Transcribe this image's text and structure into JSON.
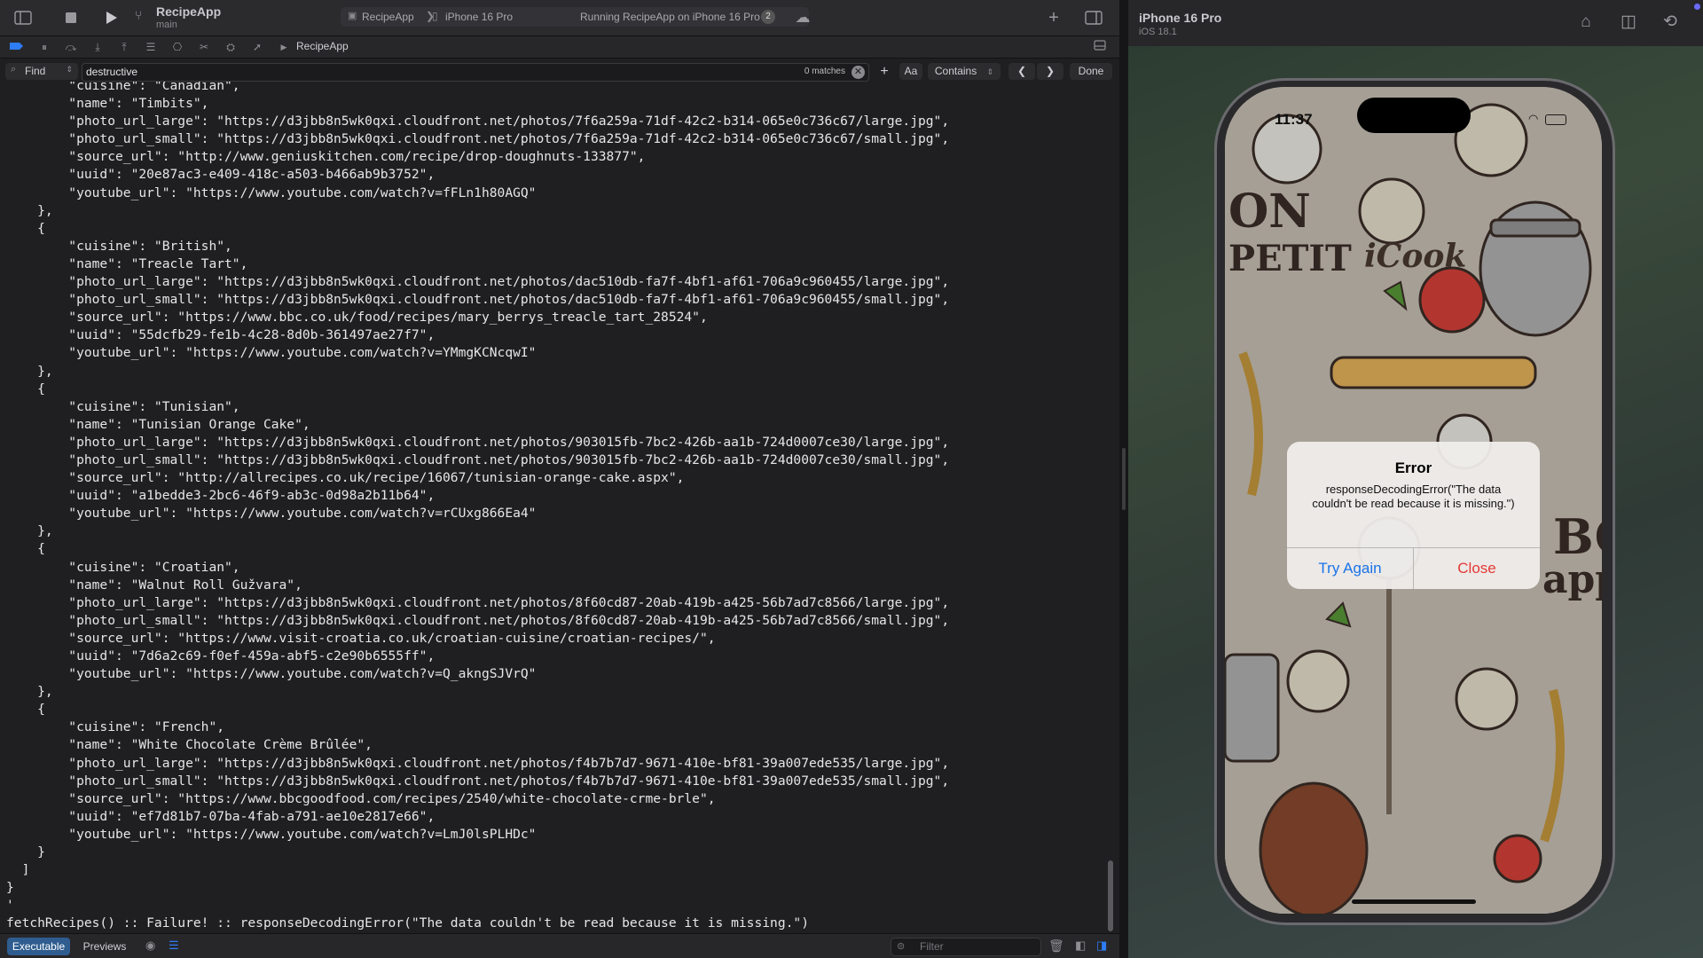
{
  "toolbar": {
    "app_name": "RecipeApp",
    "branch": "main",
    "run_destination_app": "RecipeApp",
    "run_destination_device": "iPhone 16 Pro",
    "run_status": "Running RecipeApp on iPhone 16 Pro",
    "issue_badge": "2"
  },
  "debug_bar": {
    "target": "RecipeApp"
  },
  "find_bar": {
    "mode": "Find",
    "query": "destructive",
    "match_count": "0 matches",
    "case_toggle": "Aa",
    "match_type": "Contains",
    "done_label": "Done"
  },
  "console": {
    "lines": [
      "        \"cuisine\": \"Canadian\",",
      "        \"name\": \"Timbits\",",
      "        \"photo_url_large\": \"https://d3jbb8n5wk0qxi.cloudfront.net/photos/7f6a259a-71df-42c2-b314-065e0c736c67/large.jpg\",",
      "        \"photo_url_small\": \"https://d3jbb8n5wk0qxi.cloudfront.net/photos/7f6a259a-71df-42c2-b314-065e0c736c67/small.jpg\",",
      "        \"source_url\": \"http://www.geniuskitchen.com/recipe/drop-doughnuts-133877\",",
      "        \"uuid\": \"20e87ac3-e409-418c-a503-b466ab9b3752\",",
      "        \"youtube_url\": \"https://www.youtube.com/watch?v=fFLn1h80AGQ\"",
      "    },",
      "    {",
      "        \"cuisine\": \"British\",",
      "        \"name\": \"Treacle Tart\",",
      "        \"photo_url_large\": \"https://d3jbb8n5wk0qxi.cloudfront.net/photos/dac510db-fa7f-4bf1-af61-706a9c960455/large.jpg\",",
      "        \"photo_url_small\": \"https://d3jbb8n5wk0qxi.cloudfront.net/photos/dac510db-fa7f-4bf1-af61-706a9c960455/small.jpg\",",
      "        \"source_url\": \"https://www.bbc.co.uk/food/recipes/mary_berrys_treacle_tart_28524\",",
      "        \"uuid\": \"55dcfb29-fe1b-4c28-8d0b-361497ae27f7\",",
      "        \"youtube_url\": \"https://www.youtube.com/watch?v=YMmgKCNcqwI\"",
      "    },",
      "    {",
      "        \"cuisine\": \"Tunisian\",",
      "        \"name\": \"Tunisian Orange Cake\",",
      "        \"photo_url_large\": \"https://d3jbb8n5wk0qxi.cloudfront.net/photos/903015fb-7bc2-426b-aa1b-724d0007ce30/large.jpg\",",
      "        \"photo_url_small\": \"https://d3jbb8n5wk0qxi.cloudfront.net/photos/903015fb-7bc2-426b-aa1b-724d0007ce30/small.jpg\",",
      "        \"source_url\": \"http://allrecipes.co.uk/recipe/16067/tunisian-orange-cake.aspx\",",
      "        \"uuid\": \"a1bedde3-2bc6-46f9-ab3c-0d98a2b11b64\",",
      "        \"youtube_url\": \"https://www.youtube.com/watch?v=rCUxg866Ea4\"",
      "    },",
      "    {",
      "        \"cuisine\": \"Croatian\",",
      "        \"name\": \"Walnut Roll Gužvara\",",
      "        \"photo_url_large\": \"https://d3jbb8n5wk0qxi.cloudfront.net/photos/8f60cd87-20ab-419b-a425-56b7ad7c8566/large.jpg\",",
      "        \"photo_url_small\": \"https://d3jbb8n5wk0qxi.cloudfront.net/photos/8f60cd87-20ab-419b-a425-56b7ad7c8566/small.jpg\",",
      "        \"source_url\": \"https://www.visit-croatia.co.uk/croatian-cuisine/croatian-recipes/\",",
      "        \"uuid\": \"7d6a2c69-f0ef-459a-abf5-c2e90b6555ff\",",
      "        \"youtube_url\": \"https://www.youtube.com/watch?v=Q_akngSJVrQ\"",
      "    },",
      "    {",
      "        \"cuisine\": \"French\",",
      "        \"name\": \"White Chocolate Crème Brûlée\",",
      "        \"photo_url_large\": \"https://d3jbb8n5wk0qxi.cloudfront.net/photos/f4b7b7d7-9671-410e-bf81-39a007ede535/large.jpg\",",
      "        \"photo_url_small\": \"https://d3jbb8n5wk0qxi.cloudfront.net/photos/f4b7b7d7-9671-410e-bf81-39a007ede535/small.jpg\",",
      "        \"source_url\": \"https://www.bbcgoodfood.com/recipes/2540/white-chocolate-crme-brle\",",
      "        \"uuid\": \"ef7d81b7-07ba-4fab-a791-ae10e2817e66\",",
      "        \"youtube_url\": \"https://www.youtube.com/watch?v=LmJ0lsPLHDc\"",
      "    }",
      "  ]",
      "}",
      "'",
      "fetchRecipes() :: Failure! :: responseDecodingError(\"The data couldn't be read because it is missing.\")"
    ]
  },
  "bottom_bar": {
    "executable_label": "Executable",
    "previews_label": "Previews",
    "filter_placeholder": "Filter"
  },
  "simulator": {
    "device_name": "iPhone 16 Pro",
    "os_version": "iOS 18.1",
    "clock": "11:37",
    "app_logo": "iCook",
    "background_text_1": "ON",
    "background_text_2": "PETIT",
    "background_text_3": "BO",
    "background_text_4": "appe",
    "alert": {
      "title": "Error",
      "message": "responseDecodingError(\"The data couldn't be read because it is missing.\")",
      "try_again_label": "Try Again",
      "close_label": "Close"
    }
  },
  "colors": {
    "alert_try_again": "#1a73e8",
    "alert_close": "#e53935",
    "executable_active": "#2f5d8f"
  }
}
